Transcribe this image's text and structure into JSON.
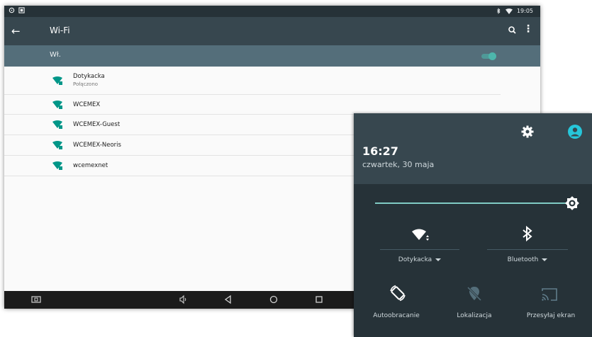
{
  "status_bar": {
    "time": "19:05",
    "left_icons": [
      "sync-icon",
      "screenshot-icon"
    ],
    "right_icons": [
      "bluetooth-icon",
      "wifi-icon"
    ]
  },
  "app_bar": {
    "title": "Wi-Fi"
  },
  "wifi_toggle": {
    "label": "Wł.",
    "enabled": true
  },
  "networks": [
    {
      "name": "Dotykacka",
      "status": "Połączono"
    },
    {
      "name": "WCEMEX",
      "status": ""
    },
    {
      "name": "WCEMEX-Guest",
      "status": ""
    },
    {
      "name": "WCEMEX-Neoris",
      "status": ""
    },
    {
      "name": "wcemexnet",
      "status": ""
    }
  ],
  "quick_settings": {
    "time": "16:27",
    "date": "czwartek, 30 maja",
    "brightness_level": 0.95,
    "tiles": {
      "wifi": {
        "label": "Dotykacka"
      },
      "bluetooth": {
        "label": "Bluetooth"
      },
      "rotate": {
        "label": "Autoobracanie"
      },
      "location": {
        "label": "Lokalizacja"
      },
      "cast": {
        "label": "Przesyłaj ekran"
      }
    }
  },
  "colors": {
    "accent": "#4db6ac",
    "appbar": "#37474f",
    "panel": "#263238",
    "wifi_icon": "#009688"
  }
}
